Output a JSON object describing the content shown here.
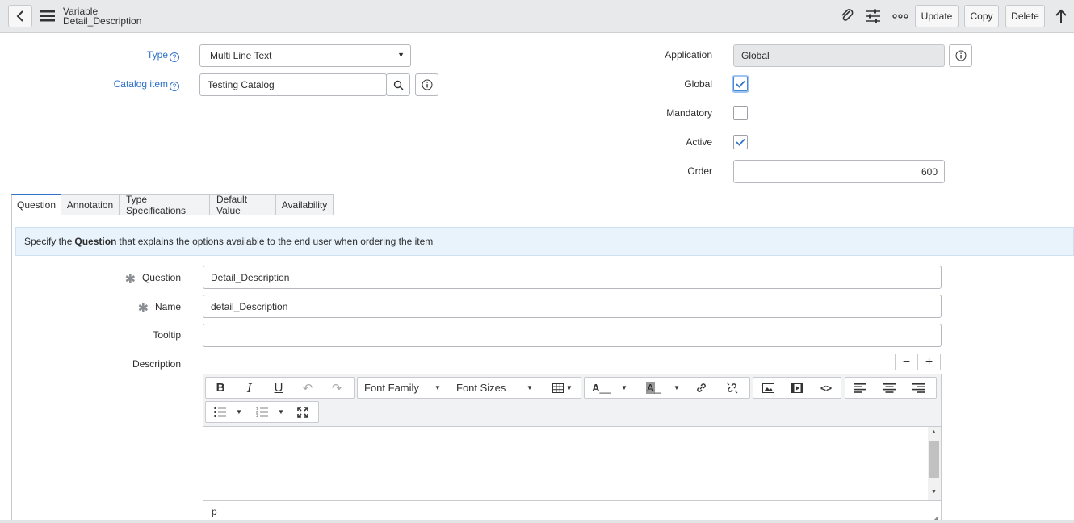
{
  "header": {
    "record_type": "Variable",
    "record_name": "Detail_Description",
    "buttons": {
      "update": "Update",
      "copy": "Copy",
      "delete": "Delete"
    }
  },
  "form": {
    "type": {
      "label": "Type",
      "value": "Multi Line Text"
    },
    "catalog_item": {
      "label": "Catalog item",
      "value": "Testing Catalog"
    },
    "application": {
      "label": "Application",
      "value": "Global"
    },
    "global": {
      "label": "Global",
      "checked": true
    },
    "mandatory": {
      "label": "Mandatory",
      "checked": false
    },
    "active": {
      "label": "Active",
      "checked": true
    },
    "order": {
      "label": "Order",
      "value": "600"
    }
  },
  "tabs": [
    {
      "label": "Question",
      "active": true
    },
    {
      "label": "Annotation"
    },
    {
      "label": "Type Specifications"
    },
    {
      "label": "Default Value"
    },
    {
      "label": "Availability"
    }
  ],
  "info": {
    "prefix": "Specify the",
    "bold": "Question",
    "suffix": "that explains the options available to the end user when ordering the item"
  },
  "question_section": {
    "question": {
      "label": "Question",
      "value": "Detail_Description"
    },
    "name": {
      "label": "Name",
      "value": "detail_Description"
    },
    "tooltip": {
      "label": "Tooltip",
      "value": ""
    },
    "description": {
      "label": "Description"
    }
  },
  "editor": {
    "font_family": "Font Family",
    "font_sizes": "Font Sizes",
    "status_path": "p",
    "minus": "−",
    "plus": "+"
  },
  "colors": {
    "link": "#2f73c6",
    "header_bg": "#e8e9ea",
    "info_bg": "#e8f3fc"
  }
}
